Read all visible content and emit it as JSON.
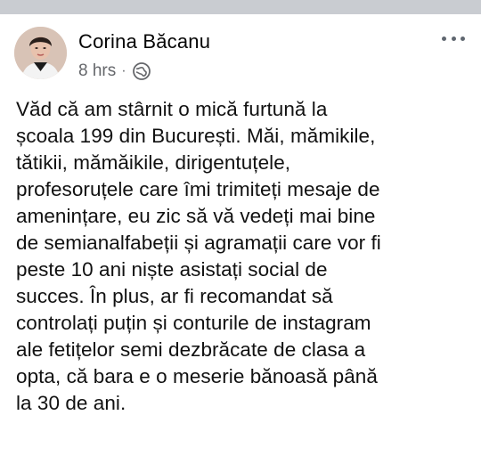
{
  "post": {
    "author": "Corina Băcanu",
    "timestamp": "8 hrs",
    "separator": "·",
    "privacy_icon": "globe-icon",
    "more_icon": "more-options-icon",
    "lines": [
      "Văd că am stârnit o mică furtună la",
      "școala 199 din București. Măi, mămikile,",
      "tătikii, mămăikile, dirigentuțele,",
      "profesoruțele care îmi trimiteți mesaje de",
      "amenințare, eu zic să vă vedeți mai bine",
      "de semianalfabeții și agramații care vor fi",
      "peste 10 ani niște asistați social de",
      "succes. În plus, ar fi recomandat să",
      "controlați puțin și conturile de instagram",
      "ale fetițelor semi dezbrăcate de clasa a",
      "opta, că bara e o meserie bănoasă până",
      "la 30 de ani."
    ]
  },
  "colors": {
    "top_band": "#c9ccd1",
    "meta_text": "#65676b",
    "body_text": "#111111"
  }
}
